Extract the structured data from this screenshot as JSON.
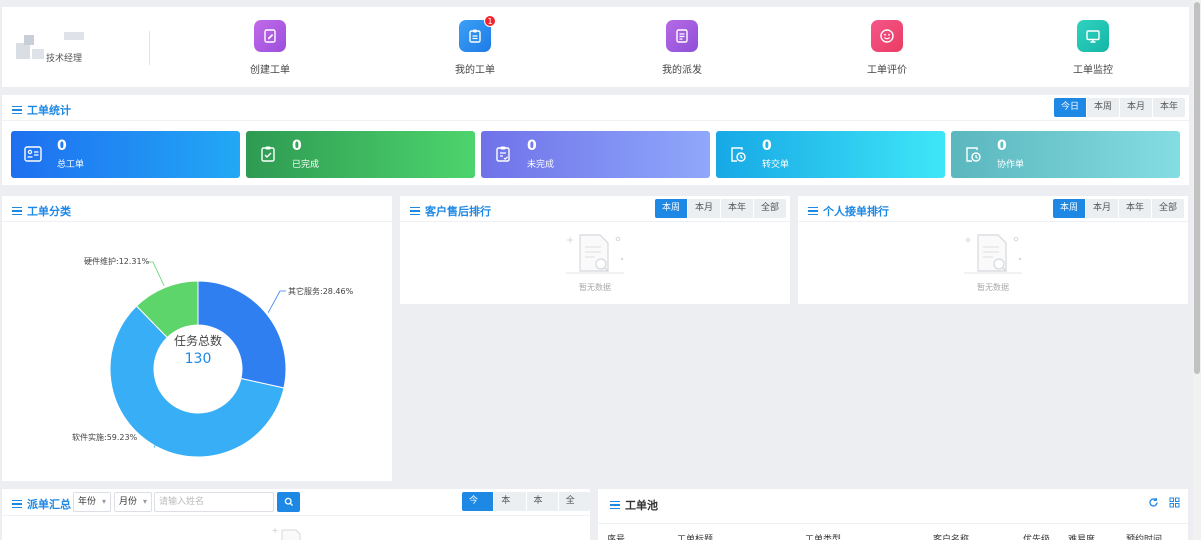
{
  "user": {
    "role": "技术经理"
  },
  "nav": [
    {
      "label": "创建工单",
      "icon": "edit-icon",
      "color": "#b15ee0"
    },
    {
      "label": "我的工单",
      "icon": "clipboard-icon",
      "color": "#2f8ff0",
      "badge": "1"
    },
    {
      "label": "我的派发",
      "icon": "dispatch-icon",
      "color": "#a05ad6"
    },
    {
      "label": "工单评价",
      "icon": "smile-icon",
      "color": "#ef4a72"
    },
    {
      "label": "工单监控",
      "icon": "monitor-icon",
      "color": "#22c4b2"
    }
  ],
  "stats": {
    "title": "工单统计",
    "ranges": [
      "今日",
      "本周",
      "本月",
      "本年"
    ],
    "active_range": "今日",
    "cards": [
      {
        "value": "0",
        "label": "总工单",
        "icon": "id-card-icon"
      },
      {
        "value": "0",
        "label": "已完成",
        "icon": "clipboard-check-icon"
      },
      {
        "value": "0",
        "label": "未完成",
        "icon": "clipboard-pending-icon"
      },
      {
        "value": "0",
        "label": "转交单",
        "icon": "clock-doc-icon"
      },
      {
        "value": "0",
        "label": "协作单",
        "icon": "clock-doc-icon"
      }
    ]
  },
  "category": {
    "title": "工单分类",
    "center_title": "任务总数",
    "center_value": "130",
    "slice_labels": [
      "其它服务:28.46%",
      "软件实施:59.23%",
      "硬件维护:12.31%"
    ]
  },
  "chart_data": {
    "type": "pie",
    "title": "工单分类",
    "labels": [
      "其它服务",
      "软件实施",
      "硬件维护"
    ],
    "values": [
      28.46,
      59.23,
      12.31
    ],
    "colors": [
      "#2f7ff0",
      "#38aef7",
      "#5dd56a"
    ],
    "total": 130
  },
  "rank_customer": {
    "title": "客户售后排行",
    "ranges": [
      "本周",
      "本月",
      "本年",
      "全部"
    ],
    "active_range": "本周",
    "empty_text": "暂无数据"
  },
  "rank_personal": {
    "title": "个人接单排行",
    "ranges": [
      "本周",
      "本月",
      "本年",
      "全部"
    ],
    "active_range": "本周",
    "empty_text": "暂无数据"
  },
  "dispatch": {
    "title": "派单汇总",
    "year_select": "年份",
    "month_select": "月份",
    "search_placeholder": "请输入姓名",
    "ranges": [
      "今日",
      "本周",
      "本月",
      "全部"
    ],
    "active_range": "今日"
  },
  "pool": {
    "title": "工单池",
    "columns": [
      "序号",
      "工单标题",
      "工单类型",
      "客户名称",
      "优先级",
      "难易度",
      "预约时间"
    ]
  }
}
